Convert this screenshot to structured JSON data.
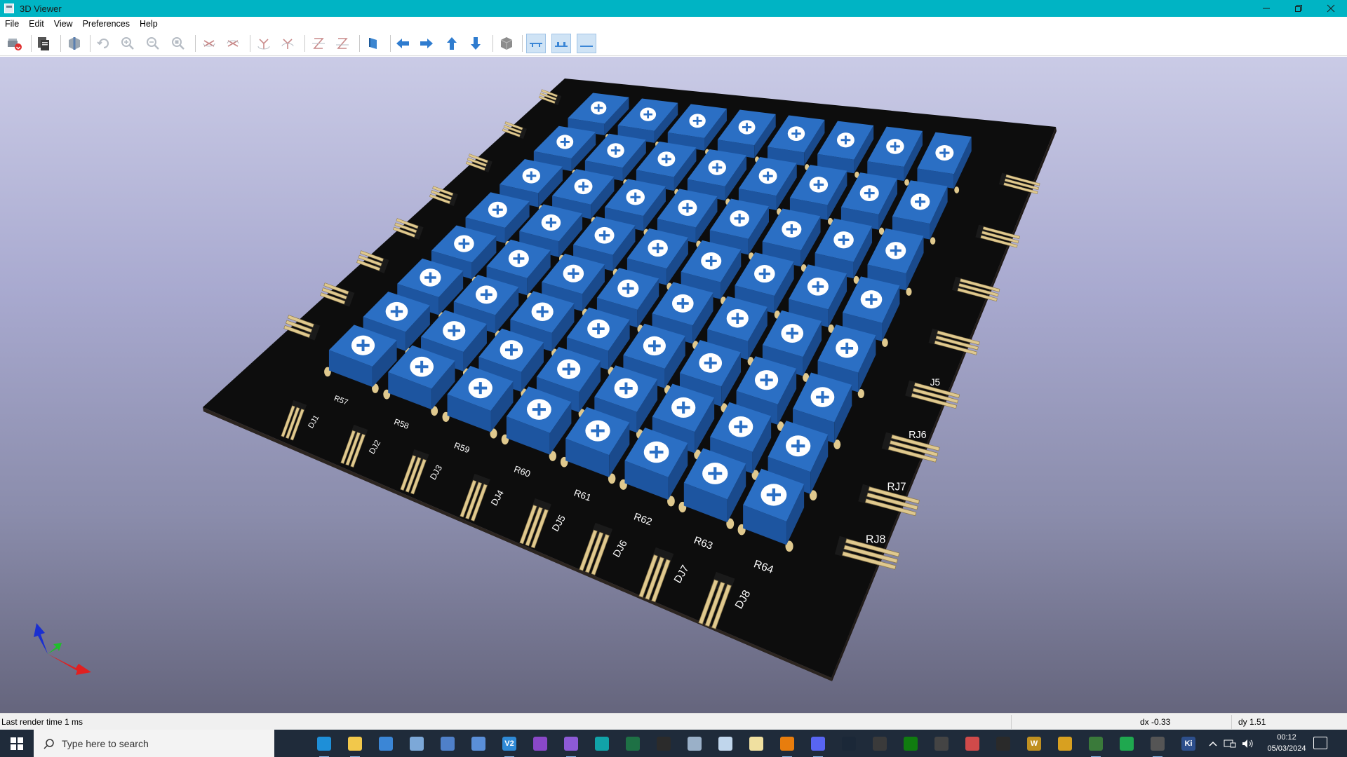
{
  "window": {
    "title": "3D Viewer"
  },
  "menu": [
    "File",
    "Edit",
    "View",
    "Preferences",
    "Help"
  ],
  "toolbar_icons": [
    "reload-board-icon",
    "copy-image-icon",
    "render-mode-icon",
    "redraw-icon",
    "zoom-in-icon",
    "zoom-out-icon",
    "zoom-fit-icon",
    "rotate-x-cw-icon",
    "rotate-x-ccw-icon",
    "rotate-y-cw-icon",
    "rotate-y-ccw-icon",
    "rotate-z-cw-icon",
    "rotate-z-ccw-icon",
    "flip-board-icon",
    "pan-left-icon",
    "pan-right-icon",
    "pan-up-icon",
    "pan-down-icon",
    "orthographic-icon",
    "view-mode-a-icon",
    "view-mode-b-icon",
    "view-mode-c-icon"
  ],
  "board": {
    "resistor_labels": [
      "R57",
      "R58",
      "R59",
      "R60",
      "R61",
      "R62",
      "R63",
      "R64"
    ],
    "bottom_connector_labels": [
      "DJ1",
      "DJ2",
      "DJ3",
      "DJ4",
      "DJ5",
      "DJ6",
      "DJ7",
      "DJ8"
    ],
    "right_connector_labels": [
      "",
      "",
      "",
      "",
      "J5",
      "RJ6",
      "RJ7",
      "RJ8"
    ],
    "colors": {
      "board": "#0d0d0d",
      "component": "#2b6fc4",
      "pin": "#e0c98e"
    }
  },
  "status": {
    "render_time": "Last render time 1 ms",
    "dx": "dx -0.33",
    "dy": "dy 1.51"
  },
  "taskbar": {
    "search_placeholder": "Type here to search",
    "time": "00:12",
    "date": "05/03/2024",
    "apps": [
      {
        "name": "task-view-icon",
        "color": "#1f2b3a",
        "label": ""
      },
      {
        "name": "edge-icon",
        "color": "#1e8fd8",
        "label": ""
      },
      {
        "name": "file-explorer-icon",
        "color": "#f2c84b",
        "label": ""
      },
      {
        "name": "store-icon",
        "color": "#3b86d6",
        "label": ""
      },
      {
        "name": "app-generic-1-icon",
        "color": "#7ca8d8",
        "label": ""
      },
      {
        "name": "app-generic-2-icon",
        "color": "#4f80c9",
        "label": ""
      },
      {
        "name": "app-generic-3-icon",
        "color": "#5a8fd8",
        "label": ""
      },
      {
        "name": "vs-code-icon",
        "color": "#2f8ad6",
        "label": "V2"
      },
      {
        "name": "github-icon",
        "color": "#8a48c8",
        "label": ""
      },
      {
        "name": "visual-studio-icon",
        "color": "#8d5ad6",
        "label": ""
      },
      {
        "name": "arduino-icon",
        "color": "#11a3a8",
        "label": ""
      },
      {
        "name": "excel-icon",
        "color": "#1e7145",
        "label": ""
      },
      {
        "name": "terminal-icon",
        "color": "#2b2b2b",
        "label": ""
      },
      {
        "name": "app-generic-4-icon",
        "color": "#9ab0c8",
        "label": ""
      },
      {
        "name": "app-generic-5-icon",
        "color": "#c0d6ec",
        "label": ""
      },
      {
        "name": "app-generic-6-icon",
        "color": "#f0e0a0",
        "label": ""
      },
      {
        "name": "blender-icon",
        "color": "#e87d0d",
        "label": ""
      },
      {
        "name": "discord-icon",
        "color": "#5865f2",
        "label": ""
      },
      {
        "name": "steam-icon",
        "color": "#1b2838",
        "label": ""
      },
      {
        "name": "obs-icon",
        "color": "#3a3a3a",
        "label": ""
      },
      {
        "name": "xbox-icon",
        "color": "#107c10",
        "label": ""
      },
      {
        "name": "unity-icon",
        "color": "#444444",
        "label": ""
      },
      {
        "name": "app-generic-7-icon",
        "color": "#d04a4a",
        "label": ""
      },
      {
        "name": "app-generic-8-icon",
        "color": "#2a2a2a",
        "label": ""
      },
      {
        "name": "app-generic-9-icon",
        "color": "#c09020",
        "label": "W"
      },
      {
        "name": "app-generic-10-icon",
        "color": "#d8a020",
        "label": ""
      },
      {
        "name": "app-generic-11-icon",
        "color": "#3a7a3a",
        "label": ""
      },
      {
        "name": "chat-icon",
        "color": "#1fa84f",
        "label": ""
      },
      {
        "name": "visual-studio-2-icon",
        "color": "#555555",
        "label": ""
      },
      {
        "name": "kicad-icon",
        "color": "#2d4f8c",
        "label": "Ki"
      }
    ]
  }
}
